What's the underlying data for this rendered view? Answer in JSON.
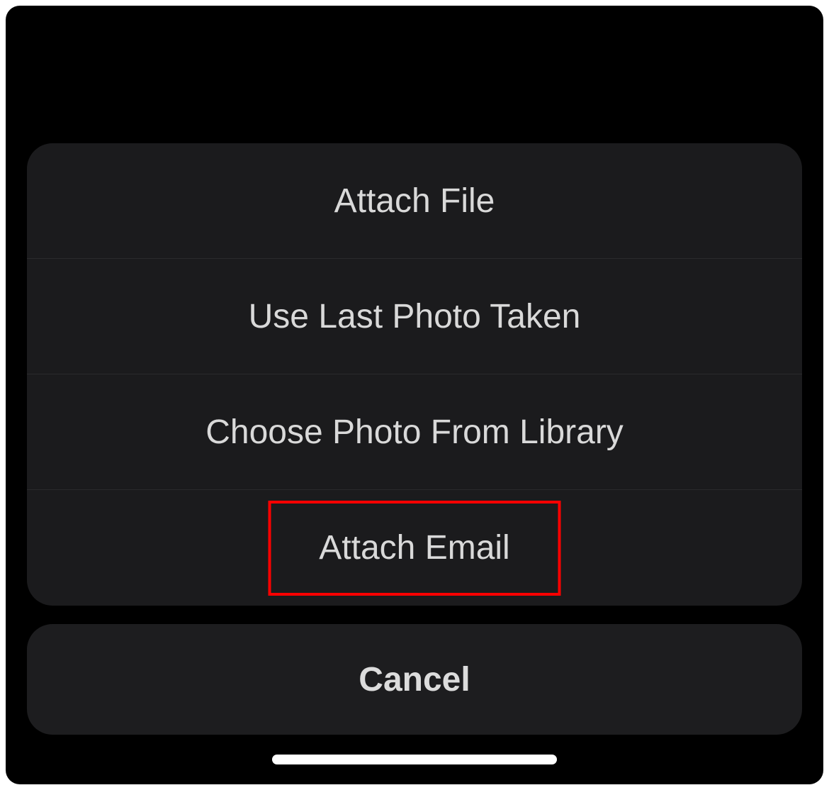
{
  "actionSheet": {
    "options": [
      {
        "label": "Attach File"
      },
      {
        "label": "Use Last Photo Taken"
      },
      {
        "label": "Choose Photo From Library"
      },
      {
        "label": "Attach Email",
        "highlighted": true
      }
    ],
    "cancel": {
      "label": "Cancel"
    }
  }
}
